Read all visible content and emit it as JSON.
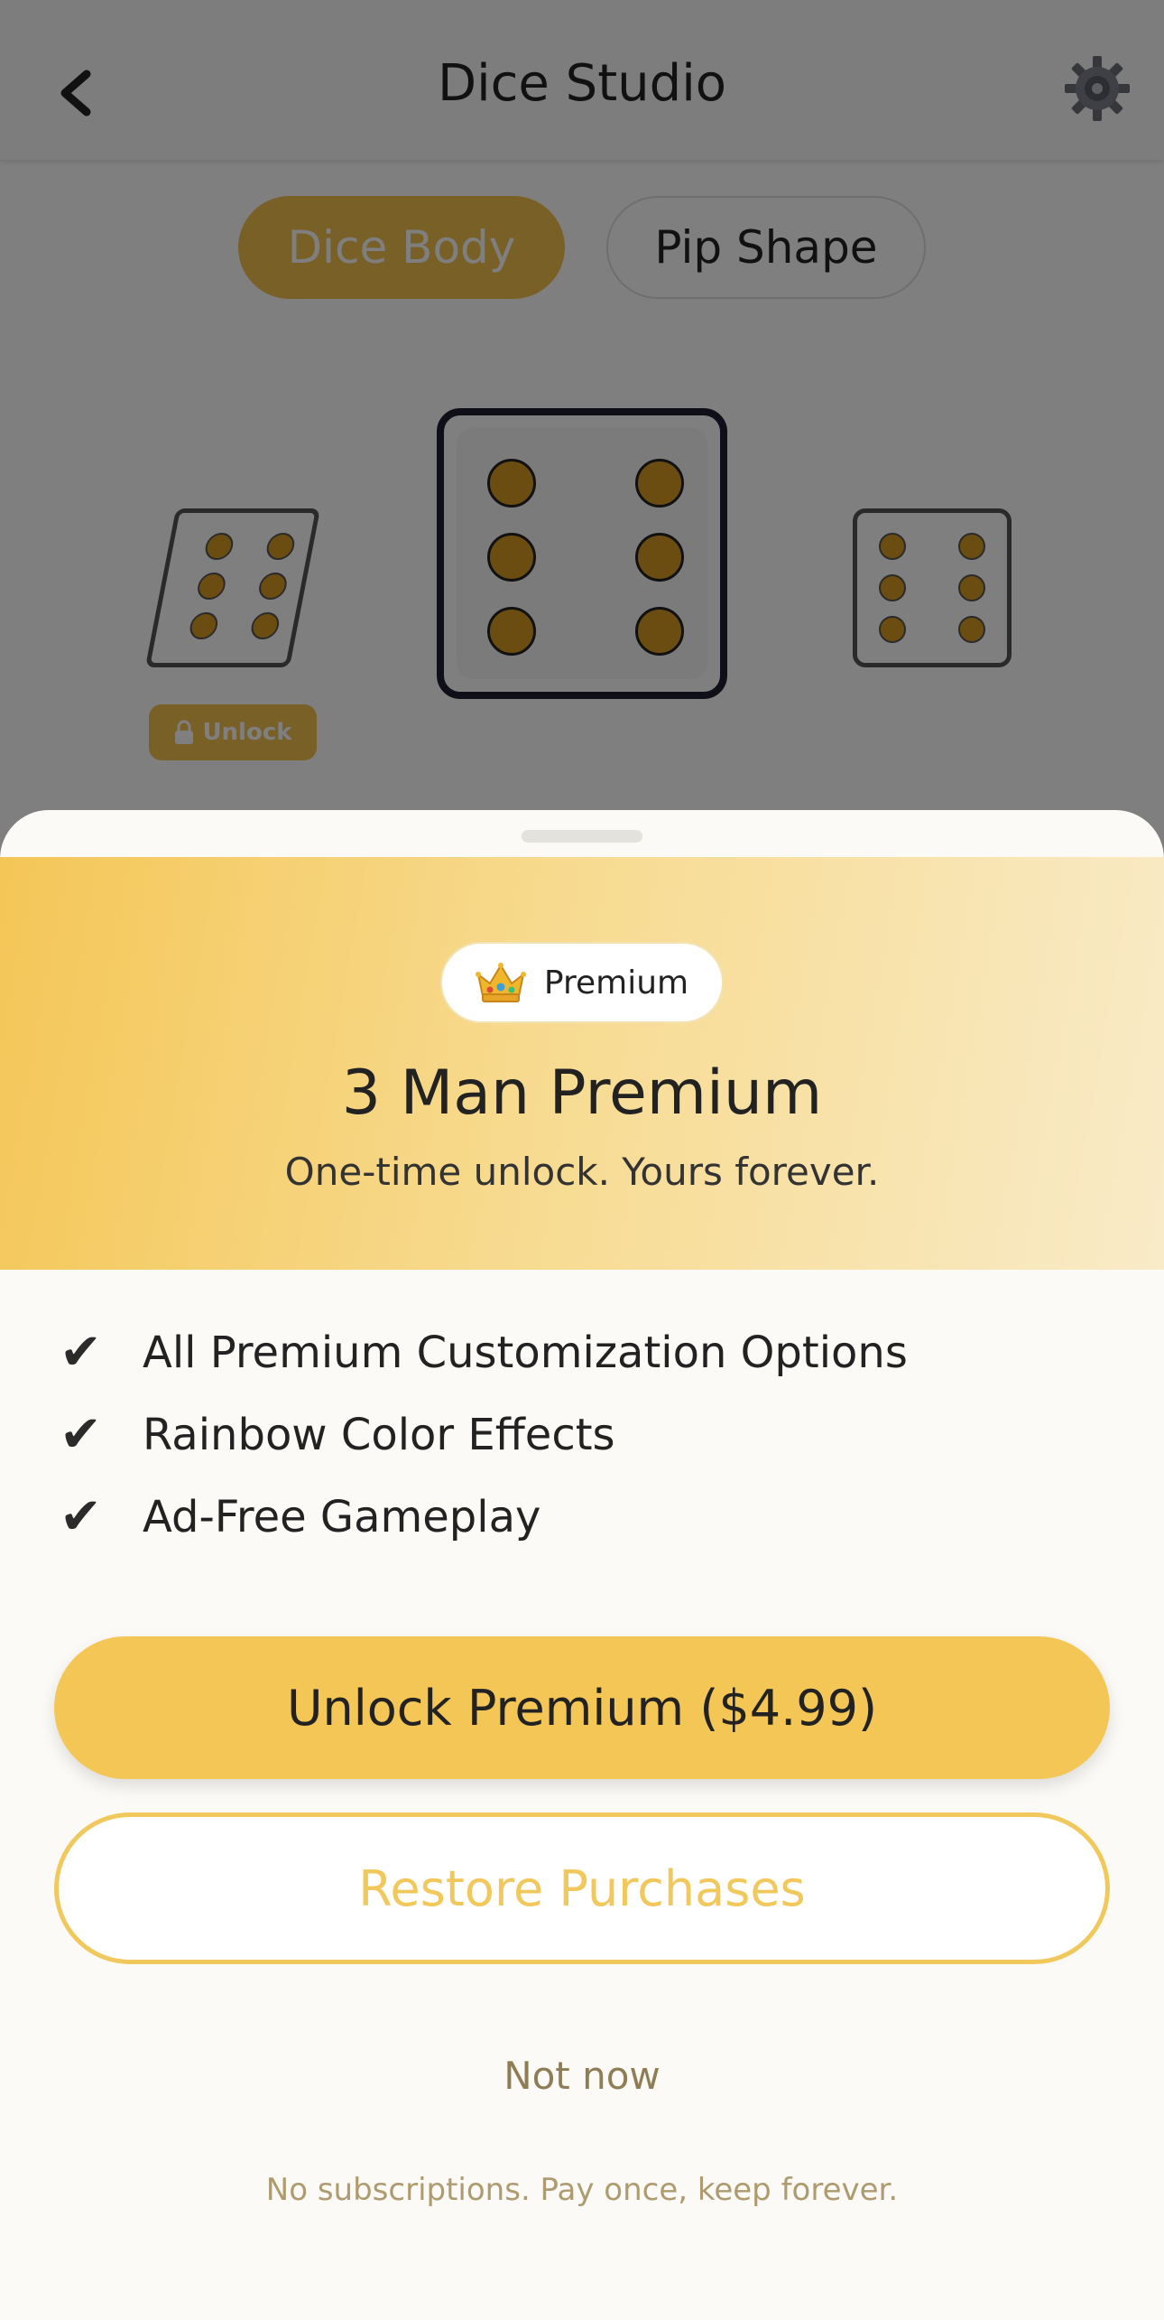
{
  "header": {
    "title": "Dice Studio",
    "back_icon": "chevron-left-icon",
    "settings_icon": "gear-icon"
  },
  "tabs": [
    {
      "label": "Dice Body",
      "selected": true
    },
    {
      "label": "Pip Shape",
      "selected": false
    }
  ],
  "dice_carousel": {
    "locked_badge": "Unlock",
    "lock_icon": "lock-icon"
  },
  "premium_sheet": {
    "badge_icon": "crown-icon",
    "badge_label": "Premium",
    "title": "3 Man Premium",
    "subtitle": "One-time unlock. Yours forever.",
    "features": [
      {
        "icon": "check-icon",
        "text": "All Premium Customization Options"
      },
      {
        "icon": "check-icon",
        "text": "Rainbow Color Effects"
      },
      {
        "icon": "check-icon",
        "text": "Ad-Free Gameplay"
      }
    ],
    "primary_button": "Unlock Premium ($4.99)",
    "secondary_button": "Restore Purchases",
    "dismiss_link": "Not now",
    "footnote": "No subscriptions. Pay once, keep forever."
  },
  "colors": {
    "accent": "#f4c655",
    "accent_outline": "#f1c85c",
    "pip": "#d79a22",
    "muted_text": "#8e7d55"
  }
}
